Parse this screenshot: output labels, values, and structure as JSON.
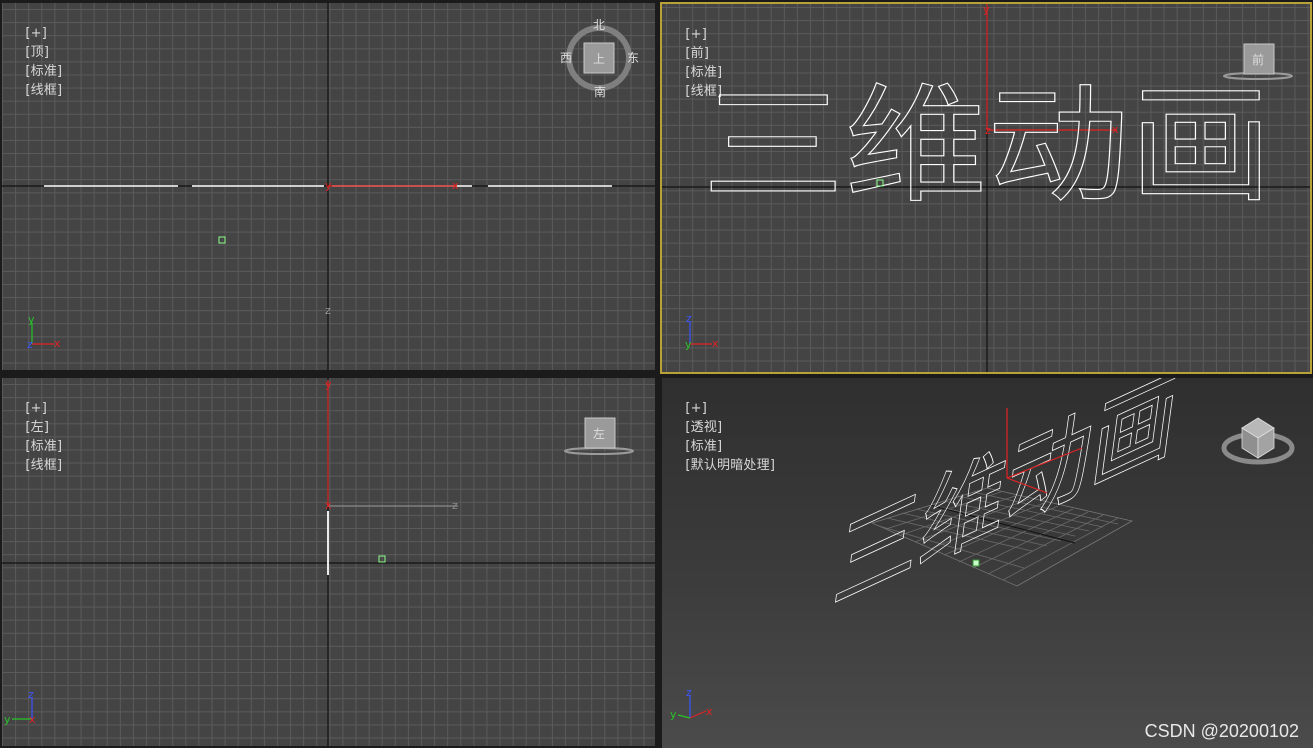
{
  "viewports": {
    "top": {
      "labels": [
        "[+]",
        "[顶]",
        "[标准]",
        "[线框]"
      ],
      "compass": {
        "center": "上",
        "north": "北",
        "south": "南",
        "east": "东",
        "west": "西"
      }
    },
    "front": {
      "labels": [
        "[+]",
        "[前]",
        "[标准]",
        "[线框]"
      ],
      "viewcube": "前"
    },
    "left": {
      "labels": [
        "[+]",
        "[左]",
        "[标准]",
        "[线框]"
      ],
      "viewcube": "左"
    },
    "persp": {
      "labels": [
        "[+]",
        "[透视]",
        "[标准]",
        "[默认明暗处理]"
      ]
    }
  },
  "scene_text": "三维动画",
  "axes": {
    "x": "x",
    "y": "y",
    "z": "z"
  },
  "colors": {
    "x_axis": "#e02424",
    "y_axis": "#28c428",
    "z_axis": "#3a56ff",
    "active_border": "#b9a13a",
    "spline": "#ffffff"
  },
  "watermark": "CSDN @20200102"
}
